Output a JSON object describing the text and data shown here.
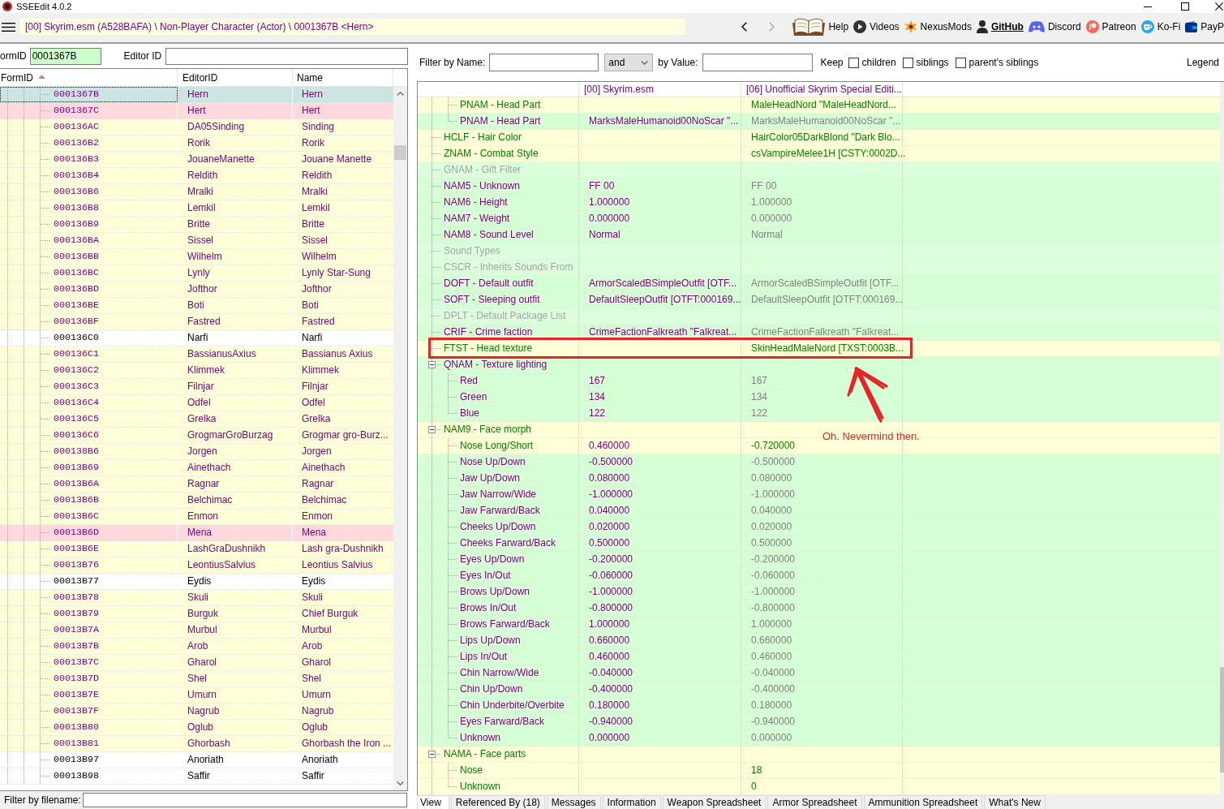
{
  "window": {
    "title": "SSEEdit 4.0.2"
  },
  "toolbar": {
    "path": "[00] Skyrim.esm (A528BAFA) \\ Non-Player Character (Actor) \\ 0001367B <Hern>",
    "back": {
      "disabled": false
    },
    "forward": {
      "disabled": true
    },
    "links": [
      {
        "label": "Help",
        "emphasized": false
      },
      {
        "label": "Videos",
        "emphasized": false
      },
      {
        "label": "NexusMods",
        "emphasized": false
      },
      {
        "label": "GitHub",
        "emphasized": true
      },
      {
        "label": "Discord",
        "emphasized": false
      },
      {
        "label": "Patreon",
        "emphasized": false
      },
      {
        "label": "Ko-Fi",
        "emphasized": false
      },
      {
        "label": "PayP",
        "emphasized": false
      }
    ]
  },
  "record_search": {
    "form_id_label": "ormID",
    "form_id": "0001367B",
    "editor_id_label": "Editor ID"
  },
  "record_list": {
    "columns": [
      {
        "label": "FormID",
        "sorted": true
      },
      {
        "label": "EditorID",
        "sorted": false
      },
      {
        "label": "Name",
        "sorted": false
      }
    ],
    "rows": [
      {
        "form_id": "0001367B",
        "editor_id": "Hern",
        "name": "Hern",
        "kind": "override",
        "selected": true
      },
      {
        "form_id": "0001367C",
        "editor_id": "Hert",
        "name": "Hert",
        "kind": "conflict",
        "selected": false
      },
      {
        "form_id": "000136AC",
        "editor_id": "DA05Sinding",
        "name": "Sinding",
        "kind": "override",
        "selected": false
      },
      {
        "form_id": "000136B2",
        "editor_id": "Rorik",
        "name": "Rorik",
        "kind": "override",
        "selected": false
      },
      {
        "form_id": "000136B3",
        "editor_id": "JouaneManette",
        "name": "Jouane Manette",
        "kind": "override",
        "selected": false
      },
      {
        "form_id": "000136B4",
        "editor_id": "Reldith",
        "name": "Reldith",
        "kind": "override",
        "selected": false
      },
      {
        "form_id": "000136B6",
        "editor_id": "Mralki",
        "name": "Mralki",
        "kind": "override",
        "selected": false
      },
      {
        "form_id": "000136B8",
        "editor_id": "Lemkil",
        "name": "Lemkil",
        "kind": "override",
        "selected": false
      },
      {
        "form_id": "000136B9",
        "editor_id": "Britte",
        "name": "Britte",
        "kind": "override",
        "selected": false
      },
      {
        "form_id": "000136BA",
        "editor_id": "Sissel",
        "name": "Sissel",
        "kind": "override",
        "selected": false
      },
      {
        "form_id": "000136BB",
        "editor_id": "Wilhelm",
        "name": "Wilhelm",
        "kind": "override",
        "selected": false
      },
      {
        "form_id": "000136BC",
        "editor_id": "Lynly",
        "name": "Lynly Star-Sung",
        "kind": "override",
        "selected": false
      },
      {
        "form_id": "000136BD",
        "editor_id": "Jofthor",
        "name": "Jofthor",
        "kind": "override",
        "selected": false
      },
      {
        "form_id": "000136BE",
        "editor_id": "Boti",
        "name": "Boti",
        "kind": "override",
        "selected": false
      },
      {
        "form_id": "000136BF",
        "editor_id": "Fastred",
        "name": "Fastred",
        "kind": "override",
        "selected": false
      },
      {
        "form_id": "000136C0",
        "editor_id": "Narfi",
        "name": "Narfi",
        "kind": "single",
        "selected": false
      },
      {
        "form_id": "000136C1",
        "editor_id": "BassianusAxius",
        "name": "Bassianus Axius",
        "kind": "override",
        "selected": false
      },
      {
        "form_id": "000136C2",
        "editor_id": "Klimmek",
        "name": "Klimmek",
        "kind": "override",
        "selected": false
      },
      {
        "form_id": "000136C3",
        "editor_id": "Filnjar",
        "name": "Filnjar",
        "kind": "override",
        "selected": false
      },
      {
        "form_id": "000136C4",
        "editor_id": "Odfel",
        "name": "Odfel",
        "kind": "override",
        "selected": false
      },
      {
        "form_id": "000136C5",
        "editor_id": "Grelka",
        "name": "Grelka",
        "kind": "override",
        "selected": false
      },
      {
        "form_id": "000136C6",
        "editor_id": "GrogmarGroBurzag",
        "name": "Grogmar gro-Burz...",
        "kind": "override",
        "selected": false
      },
      {
        "form_id": "000138B6",
        "editor_id": "Jorgen",
        "name": "Jorgen",
        "kind": "override",
        "selected": false
      },
      {
        "form_id": "00013B69",
        "editor_id": "Ainethach",
        "name": "Ainethach",
        "kind": "override",
        "selected": false
      },
      {
        "form_id": "00013B6A",
        "editor_id": "Ragnar",
        "name": "Ragnar",
        "kind": "override",
        "selected": false
      },
      {
        "form_id": "00013B6B",
        "editor_id": "Belchimac",
        "name": "Belchimac",
        "kind": "override",
        "selected": false
      },
      {
        "form_id": "00013B6C",
        "editor_id": "Enmon",
        "name": "Enmon",
        "kind": "override",
        "selected": false
      },
      {
        "form_id": "00013B6D",
        "editor_id": "Mena",
        "name": "Mena",
        "kind": "conflict",
        "selected": false
      },
      {
        "form_id": "00013B6E",
        "editor_id": "LashGraDushnikh",
        "name": "Lash gra-Dushnikh",
        "kind": "override",
        "selected": false
      },
      {
        "form_id": "00013B76",
        "editor_id": "LeontiusSalvius",
        "name": "Leontius Salvius",
        "kind": "override",
        "selected": false
      },
      {
        "form_id": "00013B77",
        "editor_id": "Eydis",
        "name": "Eydis",
        "kind": "single",
        "selected": false
      },
      {
        "form_id": "00013B78",
        "editor_id": "Skuli",
        "name": "Skuli",
        "kind": "override",
        "selected": false
      },
      {
        "form_id": "00013B79",
        "editor_id": "Burguk",
        "name": "Chief Burguk",
        "kind": "override",
        "selected": false
      },
      {
        "form_id": "00013B7A",
        "editor_id": "Murbul",
        "name": "Murbul",
        "kind": "override",
        "selected": false
      },
      {
        "form_id": "00013B7B",
        "editor_id": "Arob",
        "name": "Arob",
        "kind": "override",
        "selected": false
      },
      {
        "form_id": "00013B7C",
        "editor_id": "Gharol",
        "name": "Gharol",
        "kind": "override",
        "selected": false
      },
      {
        "form_id": "00013B7D",
        "editor_id": "Shel",
        "name": "Shel",
        "kind": "override",
        "selected": false
      },
      {
        "form_id": "00013B7E",
        "editor_id": "Umurn",
        "name": "Umurn",
        "kind": "override",
        "selected": false
      },
      {
        "form_id": "00013B7F",
        "editor_id": "Nagrub",
        "name": "Nagrub",
        "kind": "override",
        "selected": false
      },
      {
        "form_id": "00013B80",
        "editor_id": "Oglub",
        "name": "Oglub",
        "kind": "override",
        "selected": false
      },
      {
        "form_id": "00013B81",
        "editor_id": "Ghorbash",
        "name": "Ghorbash the Iron ...",
        "kind": "override",
        "selected": false
      },
      {
        "form_id": "00013B97",
        "editor_id": "Anoriath",
        "name": "Anoriath",
        "kind": "single",
        "selected": false
      },
      {
        "form_id": "00013B98",
        "editor_id": "Saffir",
        "name": "Saffir",
        "kind": "single",
        "selected": false
      }
    ]
  },
  "file_filter": {
    "label": "Filter by filename:"
  },
  "view_filter": {
    "name_label": "Filter by Name:",
    "operator": "and",
    "value_label": "by Value:",
    "keep_label": "Keep",
    "options": [
      {
        "label": "children",
        "checked": false
      },
      {
        "label": "siblings",
        "checked": false
      },
      {
        "label": "parent's siblings",
        "checked": false
      }
    ],
    "legend": "Legend"
  },
  "record_view": {
    "columns": [
      "[00] Skyrim.esm",
      "[06] Unofficial Skyrim Special Editi..."
    ],
    "rows": [
      {
        "children": [
          {
            "label": "PNAM - Head Part",
            "kind": "override",
            "override_value": "MaleHeadNord \"MaleHeadNord...",
            "highlighted": false
          },
          {
            "label": "PNAM - Head Part",
            "kind": "match",
            "master_value": "MarksMaleHumanoid00NoScar \"...",
            "override_value": "MarksMaleHumanoid00NoScar \"...",
            "highlighted": false
          }
        ]
      },
      {
        "label": "HCLF - Hair Color",
        "kind": "override",
        "override_value": "HairColor05DarkBlond \"Dark Blo...",
        "highlighted": false
      },
      {
        "label": "ZNAM - Combat Style",
        "kind": "override",
        "override_value": "csVampireMelee1H [CSTY:0002D...",
        "highlighted": false
      },
      {
        "label": "GNAM - Gift Filter",
        "kind": "absent",
        "highlighted": false
      },
      {
        "label": "NAM5 - Unknown",
        "kind": "match",
        "master_value": "FF 00",
        "override_value": "FF 00",
        "highlighted": false
      },
      {
        "label": "NAM6 - Height",
        "kind": "match",
        "master_value": "1.000000",
        "override_value": "1.000000",
        "highlighted": false
      },
      {
        "label": "NAM7 - Weight",
        "kind": "match",
        "master_value": "0.000000",
        "override_value": "0.000000",
        "highlighted": false
      },
      {
        "label": "NAM8 - Sound Level",
        "kind": "match",
        "master_value": "Normal",
        "override_value": "Normal",
        "highlighted": false
      },
      {
        "label": "Sound Types",
        "kind": "absent",
        "highlighted": false
      },
      {
        "label": "CSCR - Inherits Sounds From",
        "kind": "absent",
        "highlighted": false
      },
      {
        "label": "DOFT - Default outfit",
        "kind": "match",
        "master_value": "ArmorScaledBSimpleOutfit [OTF...",
        "override_value": "ArmorScaledBSimpleOutfit [OTF...",
        "highlighted": false
      },
      {
        "label": "SOFT - Sleeping outfit",
        "kind": "match",
        "master_value": "DefaultSleepOutfit [OTFT:000169...",
        "override_value": "DefaultSleepOutfit [OTFT:000169...",
        "highlighted": false
      },
      {
        "label": "DPLT - Default Package List",
        "kind": "absent",
        "highlighted": false
      },
      {
        "label": "CRIF - Crime faction",
        "kind": "match",
        "master_value": "CrimeFactionFalkreath \"Falkreat...",
        "override_value": "CrimeFactionFalkreath \"Falkreat...",
        "highlighted": false
      },
      {
        "label": "FTST - Head texture",
        "kind": "override",
        "override_value": "SkinHeadMaleNord [TXST:0003B...",
        "highlighted": true
      },
      {
        "label": "QNAM - Texture lighting",
        "kind": "match",
        "expanded": true,
        "highlighted": false,
        "children": [
          {
            "label": "Red",
            "kind": "match",
            "master_value": "167",
            "override_value": "167",
            "highlighted": false
          },
          {
            "label": "Green",
            "kind": "match",
            "master_value": "134",
            "override_value": "134",
            "highlighted": false
          },
          {
            "label": "Blue",
            "kind": "match",
            "master_value": "122",
            "override_value": "122",
            "highlighted": false
          }
        ]
      },
      {
        "label": "NAM9 - Face morph",
        "kind": "override",
        "expanded": true,
        "highlighted": false,
        "children": [
          {
            "label": "Nose Long/Short",
            "kind": "override",
            "master_value": "0.460000",
            "override_value": "-0.720000",
            "highlighted": false
          },
          {
            "label": "Nose Up/Down",
            "kind": "match",
            "master_value": "-0.500000",
            "override_value": "-0.500000",
            "highlighted": false
          },
          {
            "label": "Jaw Up/Down",
            "kind": "match",
            "master_value": "0.080000",
            "override_value": "0.080000",
            "highlighted": false
          },
          {
            "label": "Jaw Narrow/Wide",
            "kind": "match",
            "master_value": "-1.000000",
            "override_value": "-1.000000",
            "highlighted": false
          },
          {
            "label": "Jaw Farward/Back",
            "kind": "match",
            "master_value": "0.040000",
            "override_value": "0.040000",
            "highlighted": false
          },
          {
            "label": "Cheeks Up/Down",
            "kind": "match",
            "master_value": "0.020000",
            "override_value": "0.020000",
            "highlighted": false
          },
          {
            "label": "Cheeks Farward/Back",
            "kind": "match",
            "master_value": "0.500000",
            "override_value": "0.500000",
            "highlighted": false
          },
          {
            "label": "Eyes Up/Down",
            "kind": "match",
            "master_value": "-0.200000",
            "override_value": "-0.200000",
            "highlighted": false
          },
          {
            "label": "Eyes In/Out",
            "kind": "match",
            "master_value": "-0.060000",
            "override_value": "-0.060000",
            "highlighted": false
          },
          {
            "label": "Brows Up/Down",
            "kind": "match",
            "master_value": "-1.000000",
            "override_value": "-1.000000",
            "highlighted": false
          },
          {
            "label": "Brows In/Out",
            "kind": "match",
            "master_value": "-0.800000",
            "override_value": "-0.800000",
            "highlighted": false
          },
          {
            "label": "Brows Farward/Back",
            "kind": "match",
            "master_value": "1.000000",
            "override_value": "1.000000",
            "highlighted": false
          },
          {
            "label": "Lips Up/Down",
            "kind": "match",
            "master_value": "0.660000",
            "override_value": "0.660000",
            "highlighted": false
          },
          {
            "label": "Lips In/Out",
            "kind": "match",
            "master_value": "0.460000",
            "override_value": "0.460000",
            "highlighted": false
          },
          {
            "label": "Chin Narrow/Wide",
            "kind": "match",
            "master_value": "-0.040000",
            "override_value": "-0.040000",
            "highlighted": false
          },
          {
            "label": "Chin Up/Down",
            "kind": "match",
            "master_value": "-0.400000",
            "override_value": "-0.400000",
            "highlighted": false
          },
          {
            "label": "Chin Underbite/Overbite",
            "kind": "match",
            "master_value": "0.180000",
            "override_value": "0.180000",
            "highlighted": false
          },
          {
            "label": "Eyes Farward/Back",
            "kind": "match",
            "master_value": "-0.940000",
            "override_value": "-0.940000",
            "highlighted": false
          },
          {
            "label": "Unknown",
            "kind": "match",
            "master_value": "0.000000",
            "override_value": "0.000000",
            "highlighted": false
          }
        ]
      },
      {
        "label": "NAMA - Face parts",
        "kind": "override",
        "expanded": true,
        "highlighted": false,
        "children": [
          {
            "label": "Nose",
            "kind": "override",
            "override_value": "18",
            "highlighted": false
          },
          {
            "label": "Unknown",
            "kind": "override",
            "override_value": "0",
            "highlighted": false
          }
        ]
      }
    ]
  },
  "annotation": {
    "text": "Oh. Nevermind then."
  },
  "tabs": [
    {
      "label": "View",
      "selected": true
    },
    {
      "label": "Referenced By (18)",
      "selected": false
    },
    {
      "label": "Messages",
      "selected": false
    },
    {
      "label": "Information",
      "selected": false
    },
    {
      "label": "Weapon Spreadsheet",
      "selected": false
    },
    {
      "label": "Armor Spreadsheet",
      "selected": false
    },
    {
      "label": "Ammunition Spreadsheet",
      "selected": false
    },
    {
      "label": "What's New",
      "selected": false
    }
  ]
}
